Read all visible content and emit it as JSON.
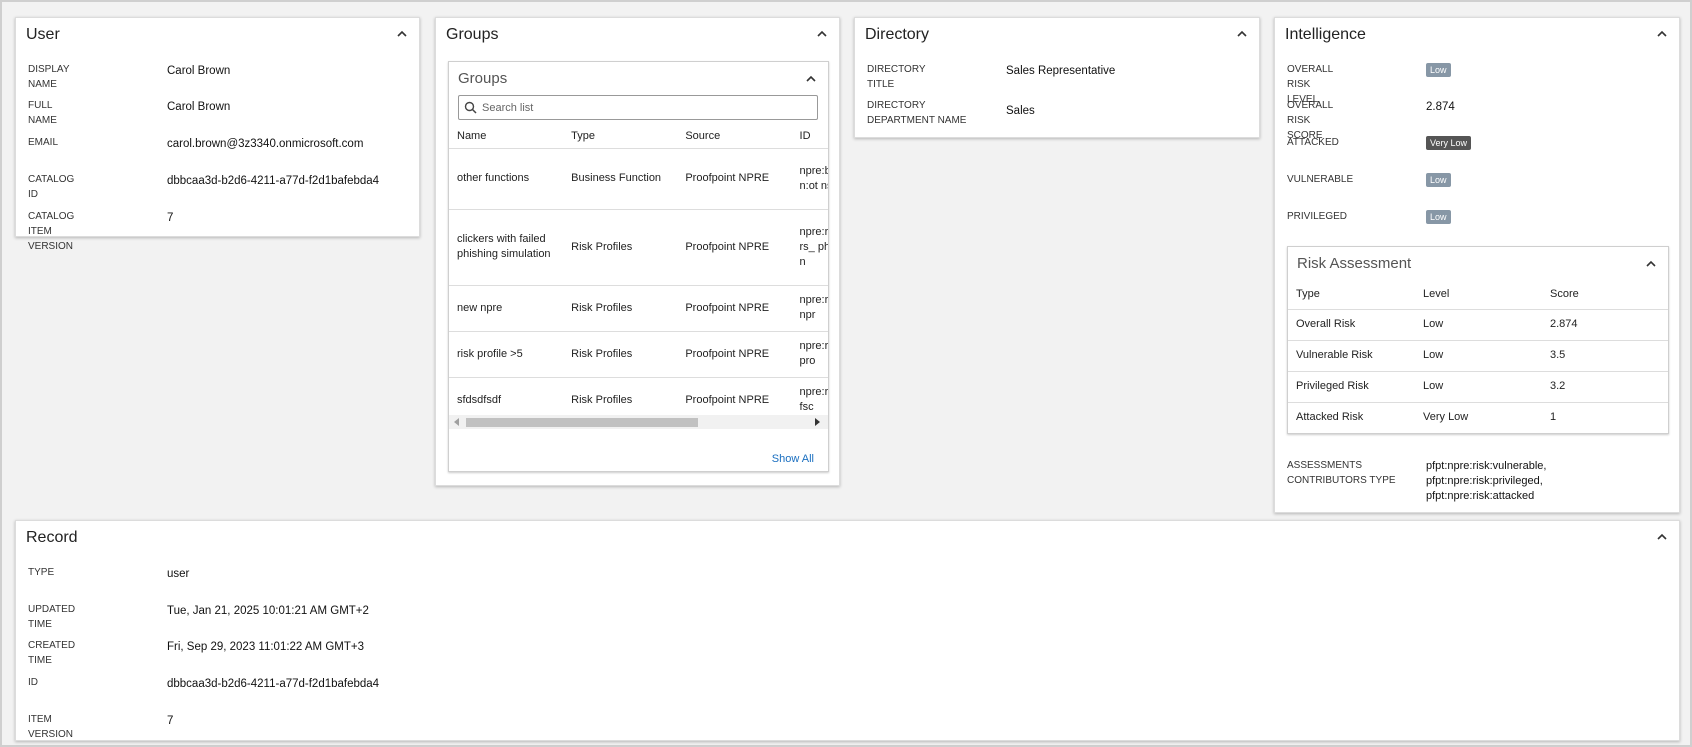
{
  "user": {
    "title": "User",
    "fields": [
      {
        "label": "DISPLAY NAME",
        "value": "Carol Brown"
      },
      {
        "label": "FULL NAME",
        "value": "Carol Brown"
      },
      {
        "label": "EMAIL",
        "value": "carol.brown@3z3340.onmicrosoft.com"
      },
      {
        "label": "CATALOG ID",
        "value": "dbbcaa3d-b2d6-4211-a77d-f2d1bafebda4"
      },
      {
        "label": "CATALOG ITEM VERSION",
        "value": "7"
      }
    ]
  },
  "groups": {
    "title": "Groups",
    "inner_title": "Groups",
    "search_placeholder": "Search list",
    "columns": [
      "Name",
      "Type",
      "Source",
      "ID"
    ],
    "rows": [
      {
        "name": "other functions",
        "type": "Business Function",
        "source": "Proofpoint NPRE",
        "id": "npre:bu ction:ot ns"
      },
      {
        "name": "clickers with failed phishing simulation",
        "type": "Risk Profiles",
        "source": "Proofpoint NPRE",
        "id": "npre:ris ickers_ phishin n"
      },
      {
        "name": "new npre",
        "type": "Risk Profiles",
        "source": "Proofpoint NPRE",
        "id": "npre:ris ew_npr"
      },
      {
        "name": "risk profile >5",
        "type": "Risk Profiles",
        "source": "Proofpoint NPRE",
        "id": "npre:ris sk_pro"
      },
      {
        "name": "sfdsdfsdf",
        "type": "Risk Profiles",
        "source": "Proofpoint NPRE",
        "id": "npre:ris fdsdfsc"
      }
    ],
    "show_all": "Show All"
  },
  "directory": {
    "title": "Directory",
    "fields": [
      {
        "label": "DIRECTORY TITLE",
        "value": "Sales Representative"
      },
      {
        "label": "DIRECTORY DEPARTMENT NAME",
        "value": "Sales"
      }
    ]
  },
  "intelligence": {
    "title": "Intelligence",
    "fields": [
      {
        "label": "OVERALL RISK LEVEL",
        "badge": "Low"
      },
      {
        "label": "OVERALL RISK SCORE",
        "value": "2.874"
      },
      {
        "label": "ATTACKED",
        "badge": "Very Low"
      },
      {
        "label": "VULNERABLE",
        "badge": "Low"
      },
      {
        "label": "PRIVILEGED",
        "badge": "Low"
      }
    ],
    "risk_assessment": {
      "title": "Risk Assessment",
      "columns": [
        "Type",
        "Level",
        "Score"
      ],
      "rows": [
        {
          "type": "Overall Risk",
          "level": "Low",
          "score": "2.874"
        },
        {
          "type": "Vulnerable Risk",
          "level": "Low",
          "score": "3.5"
        },
        {
          "type": "Privileged Risk",
          "level": "Low",
          "score": "3.2"
        },
        {
          "type": "Attacked Risk",
          "level": "Very Low",
          "score": "1"
        }
      ]
    },
    "contributors_label": "ASSESSMENTS CONTRIBUTORS TYPE",
    "contributors": [
      "pfpt:npre:risk:vulnerable,",
      "pfpt:npre:risk:privileged,",
      "pfpt:npre:risk:attacked"
    ]
  },
  "record": {
    "title": "Record",
    "fields": [
      {
        "label": "TYPE",
        "value": "user"
      },
      {
        "label": "UPDATED TIME",
        "value": "Tue, Jan 21, 2025 10:01:21 AM GMT+2"
      },
      {
        "label": "CREATED TIME",
        "value": "Fri, Sep 29, 2023 11:01:22 AM GMT+3"
      },
      {
        "label": "ID",
        "value": "dbbcaa3d-b2d6-4211-a77d-f2d1bafebda4"
      },
      {
        "label": "ITEM VERSION",
        "value": "7"
      }
    ]
  },
  "colors": {
    "accent": "#1a6fc0",
    "badge": "#8797a6",
    "badge_dark": "#555555",
    "background": "#f2f2f2"
  },
  "icons": {
    "collapse": "chevron-up-icon",
    "search": "search-icon"
  }
}
